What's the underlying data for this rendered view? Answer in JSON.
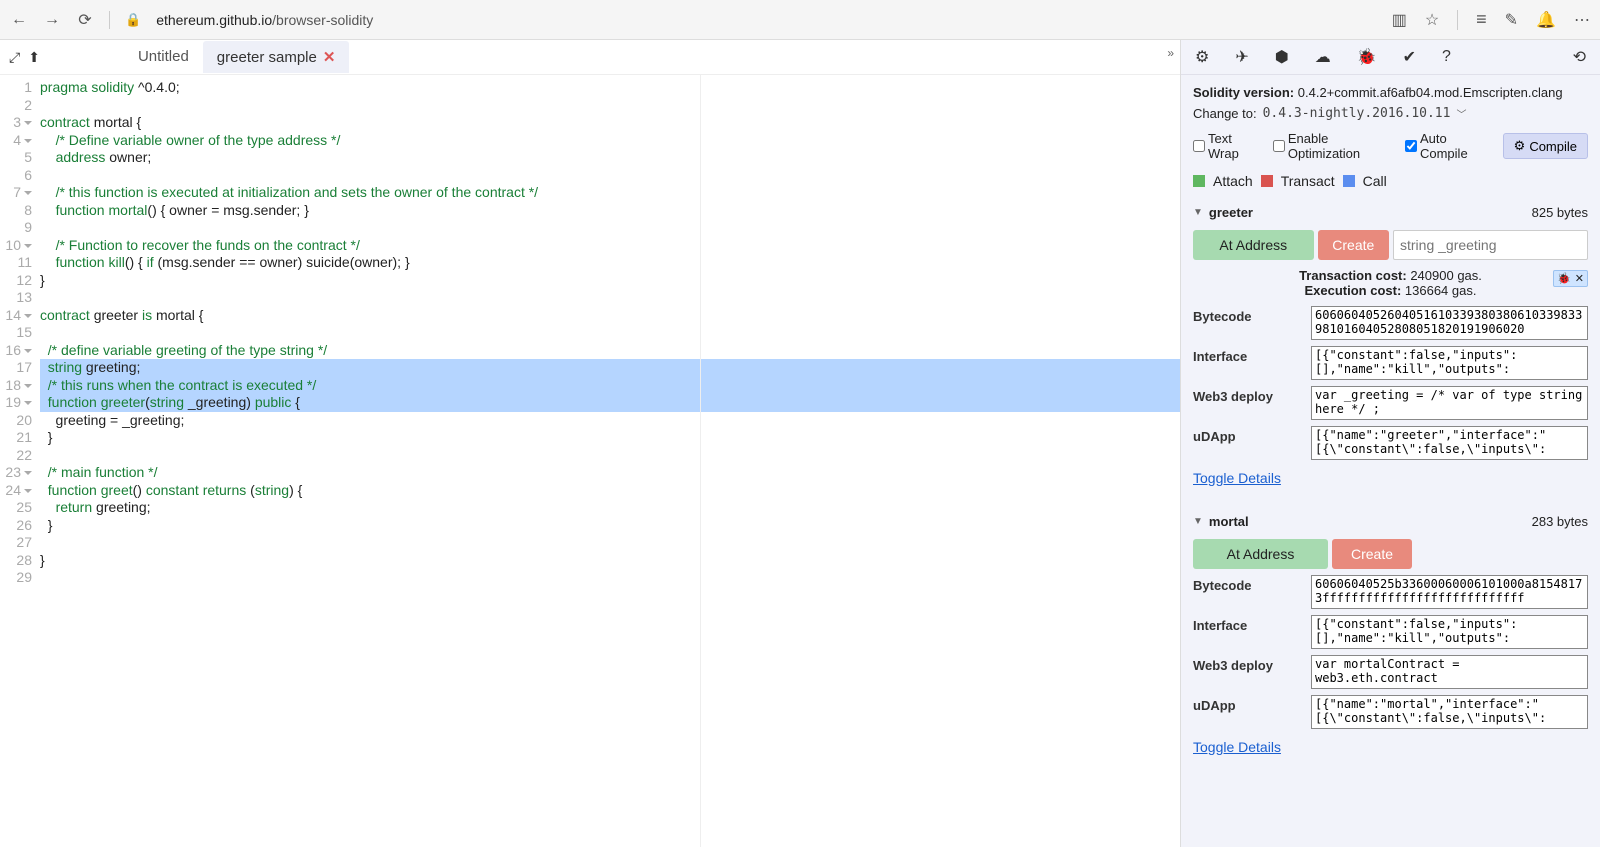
{
  "browser": {
    "url_host": "ethereum.github.io",
    "url_path": "/browser-solidity"
  },
  "tabs": {
    "t1": "Untitled",
    "t2": "greeter sample"
  },
  "code": {
    "lines": [
      {
        "n": 1,
        "fold": false,
        "hl": false,
        "html": "<span class=\"kw\">pragma</span> <span class=\"kw\">solidity</span> ^0.4.0;"
      },
      {
        "n": 2,
        "fold": false,
        "hl": false,
        "html": ""
      },
      {
        "n": 3,
        "fold": true,
        "hl": false,
        "html": "<span class=\"kw\">contract</span> mortal {"
      },
      {
        "n": 4,
        "fold": true,
        "hl": false,
        "html": "    <span class=\"cmt\">/* Define variable owner of the type address */</span>"
      },
      {
        "n": 5,
        "fold": false,
        "hl": false,
        "html": "    <span class=\"type\">address</span> owner;"
      },
      {
        "n": 6,
        "fold": false,
        "hl": false,
        "html": ""
      },
      {
        "n": 7,
        "fold": true,
        "hl": false,
        "html": "    <span class=\"cmt\">/* this function is executed at initialization and sets the owner of the contract */</span>"
      },
      {
        "n": 8,
        "fold": false,
        "hl": false,
        "html": "    <span class=\"kw\">function</span> <span class=\"fn\">mortal</span>() { owner = msg.sender; }"
      },
      {
        "n": 9,
        "fold": false,
        "hl": false,
        "html": ""
      },
      {
        "n": 10,
        "fold": true,
        "hl": false,
        "html": "    <span class=\"cmt\">/* Function to recover the funds on the contract */</span>"
      },
      {
        "n": 11,
        "fold": false,
        "hl": false,
        "html": "    <span class=\"kw\">function</span> <span class=\"fn\">kill</span>() { <span class=\"kw\">if</span> (msg.sender == owner) suicide(owner); }"
      },
      {
        "n": 12,
        "fold": false,
        "hl": false,
        "html": "}"
      },
      {
        "n": 13,
        "fold": false,
        "hl": false,
        "html": ""
      },
      {
        "n": 14,
        "fold": true,
        "hl": false,
        "html": "<span class=\"kw\">contract</span> greeter <span class=\"kw\">is</span> mortal {"
      },
      {
        "n": 15,
        "fold": false,
        "hl": false,
        "html": ""
      },
      {
        "n": 16,
        "fold": true,
        "hl": false,
        "html": "  <span class=\"cmt\">/* define variable greeting of the type string */</span>"
      },
      {
        "n": 17,
        "fold": false,
        "hl": true,
        "html": "  <span class=\"type\">string</span> greeting;"
      },
      {
        "n": 18,
        "fold": true,
        "hl": true,
        "html": "  <span class=\"cmt\">/* this runs when the contract is executed */</span>"
      },
      {
        "n": 19,
        "fold": true,
        "hl": true,
        "html": "  <span class=\"kw\">function</span> <span class=\"fn\">greeter</span>(<span class=\"type\">string</span> _greeting) <span class=\"kw\">public</span> {"
      },
      {
        "n": 20,
        "fold": false,
        "hl": false,
        "html": "    greeting = _greeting;"
      },
      {
        "n": 21,
        "fold": false,
        "hl": false,
        "html": "  }"
      },
      {
        "n": 22,
        "fold": false,
        "hl": false,
        "html": ""
      },
      {
        "n": 23,
        "fold": true,
        "hl": false,
        "html": "  <span class=\"cmt\">/* main function */</span>"
      },
      {
        "n": 24,
        "fold": true,
        "hl": false,
        "html": "  <span class=\"kw\">function</span> <span class=\"fn\">greet</span>() <span class=\"kw\">constant</span> <span class=\"kw\">returns</span> (<span class=\"type\">string</span>) {"
      },
      {
        "n": 25,
        "fold": false,
        "hl": false,
        "html": "    <span class=\"kw\">return</span> greeting;"
      },
      {
        "n": 26,
        "fold": false,
        "hl": false,
        "html": "  }"
      },
      {
        "n": 27,
        "fold": false,
        "hl": false,
        "html": ""
      },
      {
        "n": 28,
        "fold": false,
        "hl": false,
        "html": "}"
      },
      {
        "n": 29,
        "fold": false,
        "hl": false,
        "html": ""
      }
    ]
  },
  "panel": {
    "version_label": "Solidity version:",
    "version": "0.4.2+commit.af6afb04.mod.Emscripten.clang",
    "change_label": "Change to:",
    "change_value": "0.4.3-nightly.2016.10.11",
    "opt_textwrap": "Text Wrap",
    "opt_optimize": "Enable Optimization",
    "opt_autocompile": "Auto Compile",
    "compile_btn": "Compile",
    "legend": {
      "attach": "Attach",
      "transact": "Transact",
      "call": "Call"
    },
    "toggle": "Toggle Details"
  },
  "contracts": [
    {
      "name": "greeter",
      "bytes": "825 bytes",
      "ctor_ph": "string _greeting",
      "at": "At Address",
      "create": "Create",
      "tx_cost_label": "Transaction cost:",
      "tx_cost": "240900 gas.",
      "ex_cost_label": "Execution cost:",
      "ex_cost": "136664 gas.",
      "bytecode": "606060405260405161033938038061033983398101604052808051820191906020",
      "interface": "[{\"constant\":false,\"inputs\":[],\"name\":\"kill\",\"outputs\":",
      "web3": "var _greeting = /* var of type string here */ ;",
      "udapp": "[{\"name\":\"greeter\",\"interface\":\"[{\\\"constant\\\":false,\\\"inputs\\\":",
      "show_costs": true,
      "show_ctor": true
    },
    {
      "name": "mortal",
      "bytes": "283 bytes",
      "ctor_ph": "",
      "at": "At Address",
      "create": "Create",
      "bytecode": "60606040525b33600060006101000a81548173ffffffffffffffffffffffffffff",
      "interface": "[{\"constant\":false,\"inputs\":[],\"name\":\"kill\",\"outputs\":",
      "web3": "var mortalContract = web3.eth.contract",
      "udapp": "[{\"name\":\"mortal\",\"interface\":\"[{\\\"constant\\\":false,\\\"inputs\\\":",
      "show_costs": false,
      "show_ctor": false
    }
  ],
  "kv_labels": {
    "bc": "Bytecode",
    "if": "Interface",
    "w3": "Web3 deploy",
    "ud": "uDApp"
  }
}
